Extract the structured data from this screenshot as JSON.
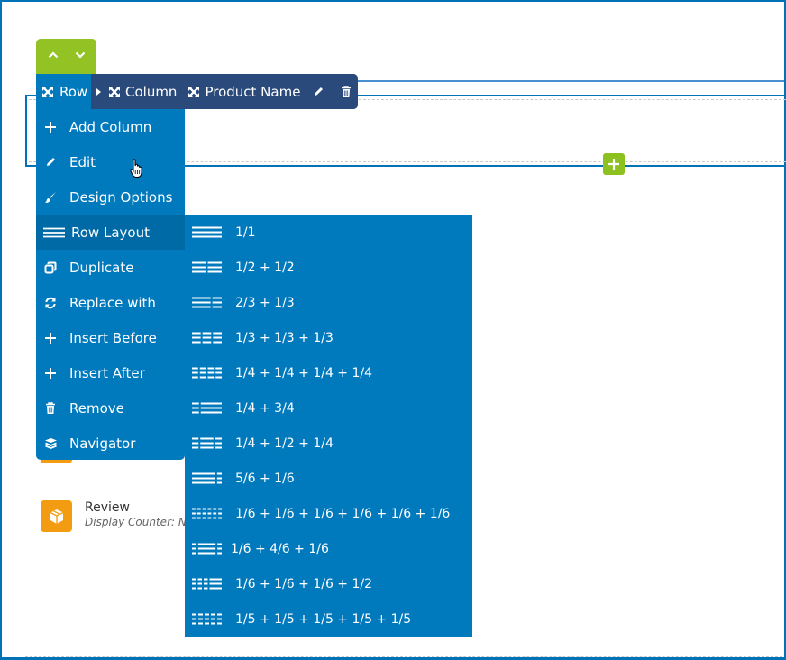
{
  "colors": {
    "frame_blue": "#0073b7",
    "menu_blue": "#0079bd",
    "toolbar_navy": "#294a7b",
    "mover_green": "#93c224",
    "element_orange": "#f39c12"
  },
  "mover": {
    "up_icon": "chevron-up-icon",
    "down_icon": "chevron-down-icon"
  },
  "breadcrumb": {
    "row_label": "Row",
    "column_label": "Column",
    "element_label": "Product Name",
    "edit_icon": "pencil-icon",
    "delete_icon": "trash-icon"
  },
  "row_menu": {
    "items": [
      {
        "label": "Add Column",
        "icon": "plus-icon"
      },
      {
        "label": "Edit",
        "icon": "pencil-icon"
      },
      {
        "label": "Design Options",
        "icon": "brush-icon"
      },
      {
        "label": "Row Layout",
        "icon": "lines-icon",
        "active": true
      },
      {
        "label": "Duplicate",
        "icon": "copy-icon"
      },
      {
        "label": "Replace with",
        "icon": "refresh-icon"
      },
      {
        "label": "Insert Before",
        "icon": "plus-icon"
      },
      {
        "label": "Insert After",
        "icon": "plus-icon"
      },
      {
        "label": "Remove",
        "icon": "trash-icon"
      },
      {
        "label": "Navigator",
        "icon": "layers-icon"
      }
    ]
  },
  "layout_menu": {
    "items": [
      {
        "label": "1/1",
        "cols": [
          1
        ]
      },
      {
        "label": "1/2 + 1/2",
        "cols": [
          0.5,
          0.5
        ]
      },
      {
        "label": "2/3 + 1/3",
        "cols": [
          0.6667,
          0.3333
        ]
      },
      {
        "label": "1/3 + 1/3 + 1/3",
        "cols": [
          0.3333,
          0.3333,
          0.3333
        ]
      },
      {
        "label": "1/4 + 1/4 + 1/4 + 1/4",
        "cols": [
          0.25,
          0.25,
          0.25,
          0.25
        ]
      },
      {
        "label": "1/4 + 3/4",
        "cols": [
          0.25,
          0.75
        ]
      },
      {
        "label": "1/4 + 1/2 + 1/4",
        "cols": [
          0.25,
          0.5,
          0.25
        ]
      },
      {
        "label": "5/6 + 1/6",
        "cols": [
          0.8333,
          0.1667
        ]
      },
      {
        "label": "1/6 + 1/6 + 1/6 + 1/6 + 1/6 + 1/6",
        "cols": [
          0.1667,
          0.1667,
          0.1667,
          0.1667,
          0.1667,
          0.1667
        ]
      },
      {
        "label": "1/6 + 4/6 + 1/6",
        "cols": [
          0.1667,
          0.6667,
          0.1667
        ]
      },
      {
        "label": "1/6 + 1/6 + 1/6 + 1/2",
        "cols": [
          0.1667,
          0.1667,
          0.1667,
          0.5
        ]
      },
      {
        "label": "1/5 + 1/5 + 1/5 + 1/5 + 1/5",
        "cols": [
          0.2,
          0.2,
          0.2,
          0.2,
          0.2
        ]
      }
    ]
  },
  "element": {
    "title": "Review",
    "subtitle": "Display Counter: No",
    "icon": "box-icon"
  },
  "add_block": {
    "icon": "plus-icon"
  }
}
